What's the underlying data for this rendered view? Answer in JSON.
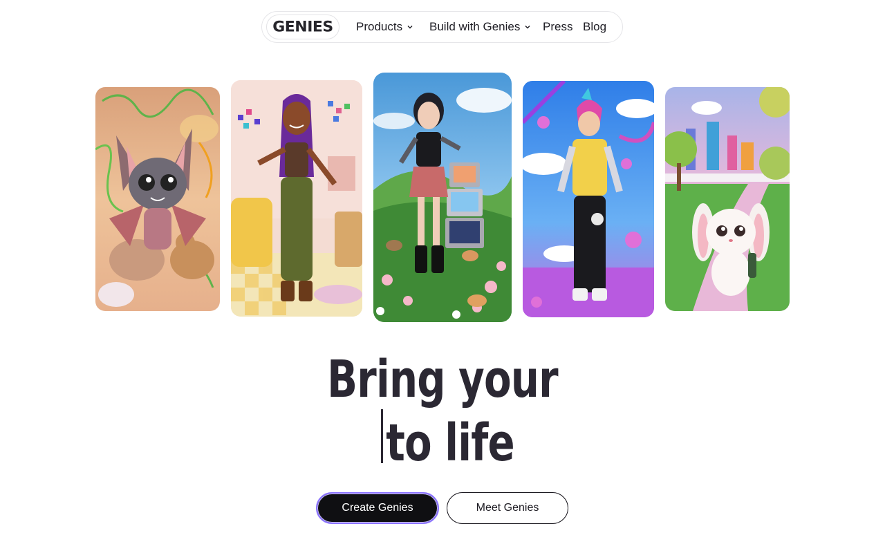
{
  "nav": {
    "logo_text": "GENIES",
    "items": [
      {
        "label": "Products",
        "has_dropdown": true
      },
      {
        "label": "Build with Genies",
        "has_dropdown": true
      },
      {
        "label": "Press",
        "has_dropdown": false
      },
      {
        "label": "Blog",
        "has_dropdown": false
      }
    ]
  },
  "gallery": {
    "cards": [
      {
        "subject": "bat-creature-with-teddy-bears",
        "bg": "#e9b48c"
      },
      {
        "subject": "girl-with-purple-braids-in-bedroom",
        "bg": "#f3d9cf"
      },
      {
        "subject": "goth-girl-with-tvs-and-cats",
        "bg": "#6fb0e0"
      },
      {
        "subject": "boy-with-pink-hair-in-cloud-world",
        "bg": "#5aa8f0"
      },
      {
        "subject": "white-bunny-in-park",
        "bg": "#e8b6d8"
      }
    ]
  },
  "hero": {
    "line1": "Bring your",
    "line2": "to life"
  },
  "cta": {
    "primary_label": "Create Genies",
    "secondary_label": "Meet Genies"
  },
  "colors": {
    "text": "#2b2833",
    "primary_bg": "#0f0f12",
    "primary_border": "#8b73ff"
  }
}
